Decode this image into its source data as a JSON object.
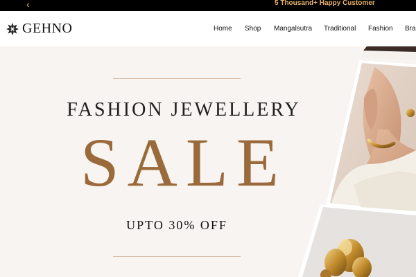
{
  "announcement": {
    "prev_icon": "chevron-left-icon",
    "prev_glyph": "‹",
    "message": "5 Thousand+ Happy Customer"
  },
  "brand": {
    "name": "GEHNO",
    "logo_icon": "flower-logo-icon"
  },
  "nav": {
    "items": [
      "Home",
      "Shop",
      "Mangalsutra",
      "Traditional",
      "Fashion",
      "Bra"
    ]
  },
  "hero": {
    "subtitle": "FASHION JEWELLERY",
    "title": "SALE",
    "offer": "UPTO 30% OFF",
    "title_color": "#9b6a3a",
    "accent_rule_color": "#d7b9a1"
  },
  "colors": {
    "announce_bg": "#000000",
    "announce_text": "#e9b36a",
    "hero_bg": "#f7f4f1"
  }
}
